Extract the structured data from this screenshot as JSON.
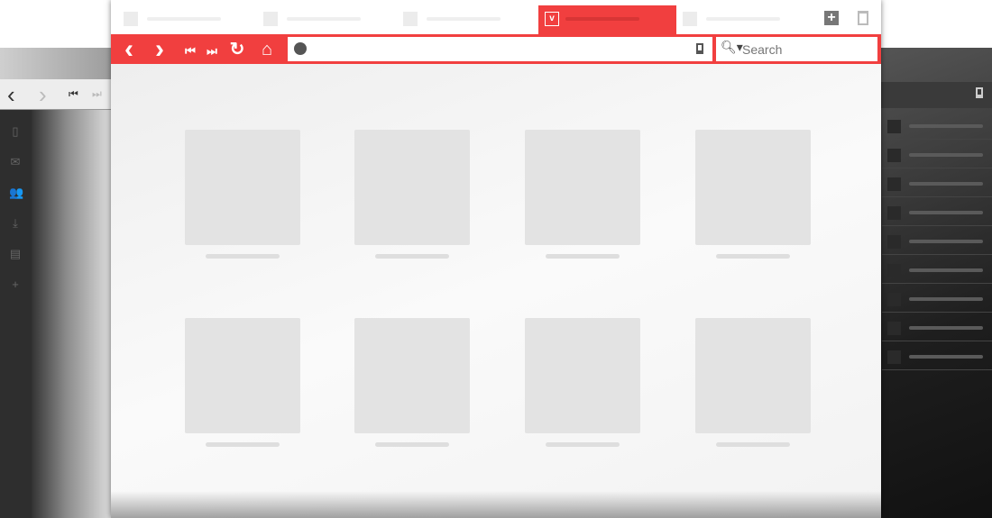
{
  "colors": {
    "accent": "#f13f3f",
    "tile": "#e3e3e3"
  },
  "toolbar": {
    "buttons": [
      {
        "name": "back-button",
        "icon": "chevron-left-icon",
        "glyph": "‹"
      },
      {
        "name": "forward-button",
        "icon": "chevron-right-icon",
        "glyph": "›"
      },
      {
        "name": "rewind-button",
        "icon": "skip-back-icon",
        "glyph": "⏮"
      },
      {
        "name": "fast-forward-button",
        "icon": "skip-forward-icon",
        "glyph": "⏭"
      },
      {
        "name": "reload-button",
        "icon": "reload-icon",
        "glyph": "↻"
      },
      {
        "name": "home-button",
        "icon": "home-icon",
        "glyph": "⌂"
      }
    ],
    "address": {
      "value": "",
      "icon": "globe-icon",
      "bookmark_icon": "bookmark-icon"
    },
    "search": {
      "placeholder": "Search",
      "icon": "search-icon"
    }
  },
  "tabs": {
    "count": 5,
    "active_index": 3,
    "active_icon": "vivaldi-logo-icon",
    "new_tab_icon": "plus-icon",
    "trash_icon": "trash-icon"
  },
  "speed_dial": {
    "tiles": 8
  },
  "left_panel": {
    "icons": [
      "bookmark-icon",
      "mail-icon",
      "contacts-icon",
      "download-icon",
      "notes-icon",
      "plus-icon"
    ]
  },
  "right_window": {
    "rows": 9
  }
}
